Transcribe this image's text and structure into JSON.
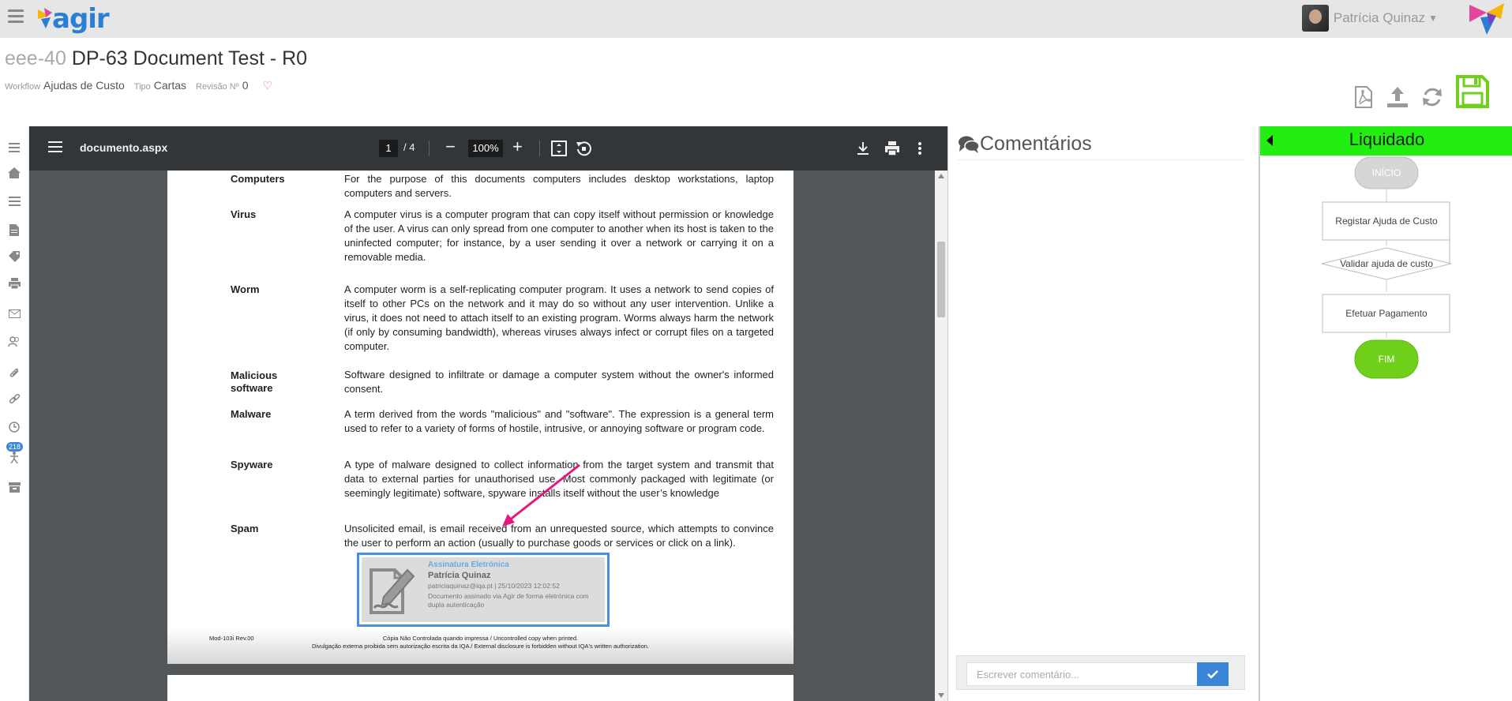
{
  "app": {
    "logo_text": "agir",
    "user_name": "Patrícia Quinaz"
  },
  "document": {
    "code": "eee-40",
    "title": "DP-63 Document Test - R0",
    "meta": {
      "workflow_label": "Workflow",
      "workflow_value": "Ajudas de Custo",
      "type_label": "Tipo",
      "type_value": "Cartas",
      "revision_label": "Revisão Nº",
      "revision_value": "0"
    }
  },
  "rail": {
    "badge": "218"
  },
  "viewer": {
    "filename": "documento.aspx",
    "page_current": "1",
    "page_total": "/ 4",
    "zoom": "100%",
    "entries": [
      {
        "term": "Computers",
        "def": "For the purpose of this documents computers includes desktop workstations, laptop computers and servers."
      },
      {
        "term": "Virus",
        "def": "A computer virus is a computer program that can copy itself without permission or knowledge of the user. A virus can only spread from one computer to another when its host is taken to the uninfected computer; for instance, by a user sending it over a network or carrying it on a removable media."
      },
      {
        "term": "Worm",
        "def": "A computer worm is a self-replicating computer program. It uses a network to send copies of itself to other PCs on the network and it may do so without any user intervention. Unlike a virus, it does not need to attach itself to an existing program. Worms always harm the network (if only by consuming bandwidth), whereas viruses always infect or corrupt files on a targeted computer."
      },
      {
        "term": "Malicious software",
        "def": "Software designed to infiltrate or damage a computer system without the owner's informed consent."
      },
      {
        "term": "Malware",
        "def": "A term derived from the words \"malicious\" and \"software\". The expression is a general term used to refer to a variety of forms of hostile, intrusive, or annoying software or program code."
      },
      {
        "term": "Spyware",
        "def": "A type of malware designed to collect information from the target system and transmit that data to external parties for unauthorised use. Most commonly packaged with legitimate (or seemingly legitimate) software, spyware installs itself without the user’s knowledge"
      },
      {
        "term": "Spam",
        "def": "Unsolicited email, is email received from an unrequested source, which attempts to convince the user to perform an action (usually to purchase goods or services or click on a link)."
      }
    ],
    "signature": {
      "title": "Assinatura Eletrónica",
      "name": "Patrícia Quinaz",
      "line": "patriciaquinaz@iqa.pt | 25/10/2023 12:02:52",
      "note": "Documento assinado via Agir de forma eletrónica com dupla autenticação"
    },
    "footer": {
      "mod": "Mod-103i  Rev.00",
      "line1": "Cópia Não Controlada quando impressa / Uncontrolled copy when printed.",
      "line2": "Divulgação externa proibida sem autorização escrita da IQA / External disclosure is forbidden without IQA's written authorization."
    }
  },
  "comments": {
    "title": "Comentários",
    "placeholder": "Escrever comentário..."
  },
  "workflow": {
    "status": "Liquidado",
    "status_color": "#22ee11",
    "nodes": {
      "start": "INÍCIO",
      "step1": "Registar Ajuda de Custo",
      "decision": "Validar ajuda de custo",
      "step2": "Efetuar Pagamento",
      "end": "FIM"
    },
    "end_color": "#6fcf1b"
  }
}
